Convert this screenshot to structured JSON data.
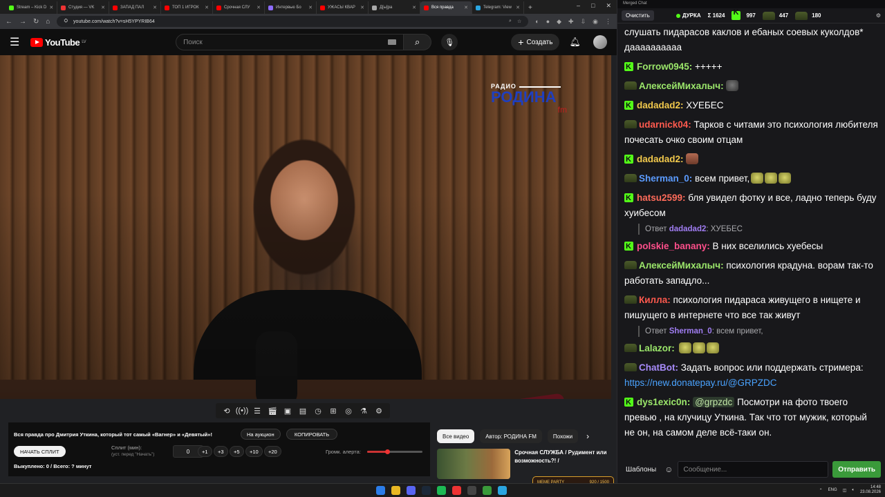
{
  "browser": {
    "tabs": [
      {
        "label": "Stream – Kick D",
        "color": "#53fc18",
        "active": false
      },
      {
        "label": "Студия — VK",
        "color": "#e33",
        "active": false
      },
      {
        "label": "ЗАПАД ПАЛ",
        "color": "#f00",
        "active": false
      },
      {
        "label": "ТОП 1 ИГРОК",
        "color": "#f00",
        "active": false
      },
      {
        "label": "Срочная СЛУ",
        "color": "#f00",
        "active": false
      },
      {
        "label": "Интервью Бо",
        "color": "#8d6cff",
        "active": false
      },
      {
        "label": "УЖАСЫ КВАР",
        "color": "#f00",
        "active": false
      },
      {
        "label": "Д[ы]ра",
        "color": "#aaa",
        "active": false
      },
      {
        "label": "Вся правда",
        "color": "#f00",
        "active": true
      },
      {
        "label": "Telegram: View",
        "color": "#2aa5e0",
        "active": false
      }
    ],
    "new_tab": "+",
    "window_controls": [
      "–",
      "□",
      "✕"
    ],
    "url": "youtube.com/watch?v=sH5YPYRIB64"
  },
  "youtube": {
    "logo": "YouTube",
    "region": "LV",
    "search_placeholder": "Поиск",
    "create_label": "Создать",
    "video_overlay": {
      "radio": "РАДИО",
      "brand": "РОДИНА",
      "fm": "fm"
    }
  },
  "panel": {
    "title": "Вся правда про Дмитрия Уткина, который тот самый «Вагнер» и «Девятый»!",
    "auction_btn": "На аукцион",
    "copy_btn": "КОПИРОВАТЬ",
    "start_split_btn": "НАЧАТЬ СПЛИТ",
    "split_label": "Сплит (мин):",
    "split_hint": "(уст. перед \"Начать\")",
    "split_value": "0",
    "steps": [
      "+1",
      "+3",
      "+5",
      "+10",
      "+20"
    ],
    "volume_label": "Громк. алерта:",
    "volume_level": 0.36,
    "bought_line": "Выкуплено: 0 / Всего: ? минут"
  },
  "chips": [
    "Все видео",
    "Автор: РОДИНА FM",
    "Похожи"
  ],
  "recommendation": {
    "title": "Срочная СЛУЖБА / Рудимент или возможность?! /"
  },
  "chat": {
    "window_title": "Merged Chat",
    "clear_btn": "Очистить",
    "streamer": "ДУРКА",
    "stats": [
      "Σ 1624",
      "997",
      "447",
      "180"
    ],
    "messages": [
      {
        "type": "cont",
        "text": "слушать пидарасов каклов и ебаных соевых куколдов* даааааааааа"
      },
      {
        "type": "msg",
        "badge": "k",
        "user": "Forrow0945",
        "color": "#9ce86b",
        "text": "+++++"
      },
      {
        "type": "msg",
        "badge": "hat",
        "user": "АлексейМихалыч",
        "color": "#9ce86b",
        "text": "",
        "emote": "dark"
      },
      {
        "type": "msg",
        "badge": "k",
        "user": "dadadad2",
        "color": "#f2c94c",
        "text": "ХУЕБЕС"
      },
      {
        "type": "msg",
        "badge": "hat",
        "user": "udarnick04",
        "color": "#ff5a4e",
        "text": "Тарков с читами это психология любителя почесать очко своим отцам"
      },
      {
        "type": "msg",
        "badge": "k",
        "user": "dadadad2",
        "color": "#f2c94c",
        "text": "",
        "emote": "face"
      },
      {
        "type": "msg",
        "badge": "hat",
        "user": "Sherman_0",
        "color": "#5b9bff",
        "text": "всем привет,",
        "emotes": 3
      },
      {
        "type": "msg",
        "badge": "k",
        "user": "hatsu2599",
        "color": "#ff6b5a",
        "text": "бля увидел фотку и все, ладно теперь буду хуибесом"
      },
      {
        "type": "reply",
        "prefix": "Ответ",
        "ruser": "dadadad2",
        "rtext": "ХУЕБЕС"
      },
      {
        "type": "msg",
        "badge": "k",
        "user": "polskie_banany",
        "color": "#ff4f8b",
        "text": "В них вселились хуебесы"
      },
      {
        "type": "msg",
        "badge": "hat",
        "user": "АлексейМихалыч",
        "color": "#9ce86b",
        "text": "психология крадуна. ворам так-то работать западло..."
      },
      {
        "type": "msg",
        "badge": "hat",
        "user": "Килла",
        "color": "#ff5a4e",
        "text": "психология  пидараса живущего в нищете и пишущего в интернете что все так живут"
      },
      {
        "type": "reply",
        "prefix": "Ответ",
        "ruser": "Sherman_0",
        "rtext": "всем привет,"
      },
      {
        "type": "msg",
        "badge": "hat",
        "user": "Lalazor",
        "color": "#9ce86b",
        "text": "",
        "emotes": 3
      },
      {
        "type": "msg",
        "badge": "hat",
        "user": "ChatBot",
        "color": "#a78bfa",
        "text": "Задать вопрос или поддержать стримера: ",
        "link": "https://new.donatepay.ru/@GRPZDC"
      },
      {
        "type": "msg",
        "badge": "k",
        "user": "dys1exic0n",
        "color": "#9ce86b",
        "mention": "@grpzdc",
        "text": "Посмотри на фото твоего превью , на клучицу Уткина. Так что тот мужик, который не он, на самом деле всё-таки он."
      }
    ],
    "templates_btn": "Шаблоны",
    "input_placeholder": "Сообщение...",
    "send_btn": "Отправить"
  },
  "taskbar": {
    "lang": "ENG",
    "time": "14:48",
    "date": "23.08.2026",
    "meme_label": "MEME PARTY",
    "meme_count": "920 / 1500"
  }
}
